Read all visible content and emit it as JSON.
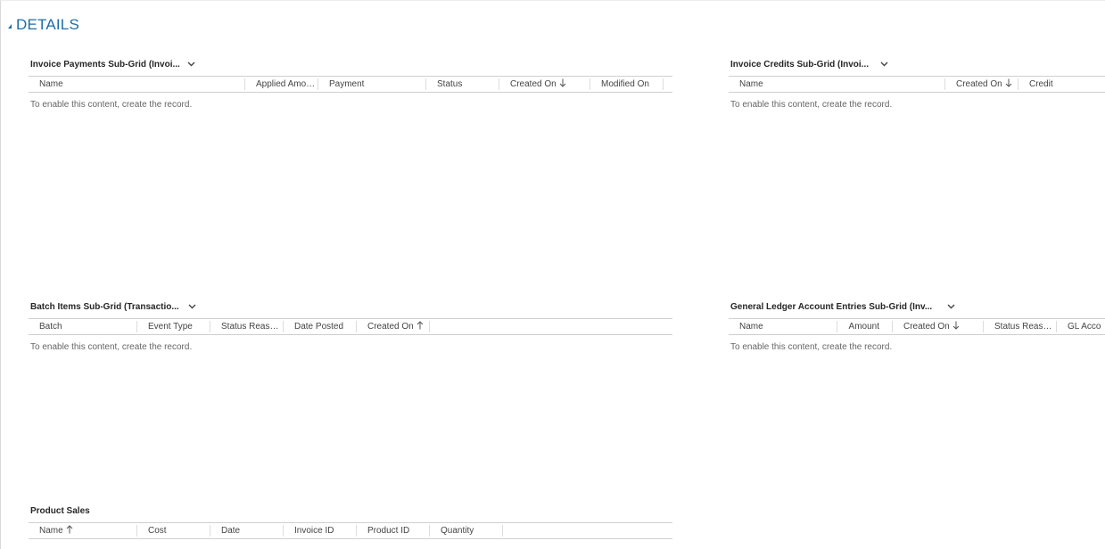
{
  "section": {
    "title": "DETAILS",
    "toggle_icon": "collapse-triangle-icon",
    "accent_color": "#1e6ea6"
  },
  "grids": {
    "invoice_payments": {
      "title": "Invoice Payments Sub-Grid (Invoi...",
      "columns": [
        "Name",
        "Applied Amou...",
        "Payment",
        "Status",
        "Created On",
        "Modified On"
      ],
      "sorted_column": "Created On",
      "sort_direction": "descending",
      "empty_message": "To enable this content, create the record."
    },
    "invoice_credits": {
      "title": "Invoice Credits Sub-Grid (Invoi...",
      "columns": [
        "Name",
        "Created On",
        "Credit"
      ],
      "sorted_column": "Created On",
      "sort_direction": "descending",
      "empty_message": "To enable this content, create the record."
    },
    "batch_items": {
      "title": "Batch Items Sub-Grid (Transactio...",
      "columns": [
        "Batch",
        "Event Type",
        "Status Reason...",
        "Date Posted",
        "Created On"
      ],
      "sorted_column": "Created On",
      "sort_direction": "ascending",
      "empty_message": "To enable this content, create the record."
    },
    "gl_entries": {
      "title": "General Ledger Account Entries Sub-Grid (Inv...",
      "columns": [
        "Name",
        "Amount",
        "Created On",
        "Status Reason...",
        "GL Acco"
      ],
      "sorted_column": "Created On",
      "sort_direction": "descending",
      "empty_message": "To enable this content, create the record."
    },
    "product_sales": {
      "title": "Product Sales",
      "columns": [
        "Name",
        "Cost",
        "Date",
        "Invoice ID",
        "Product ID",
        "Quantity"
      ],
      "sorted_column": "Name",
      "sort_direction": "ascending"
    }
  }
}
